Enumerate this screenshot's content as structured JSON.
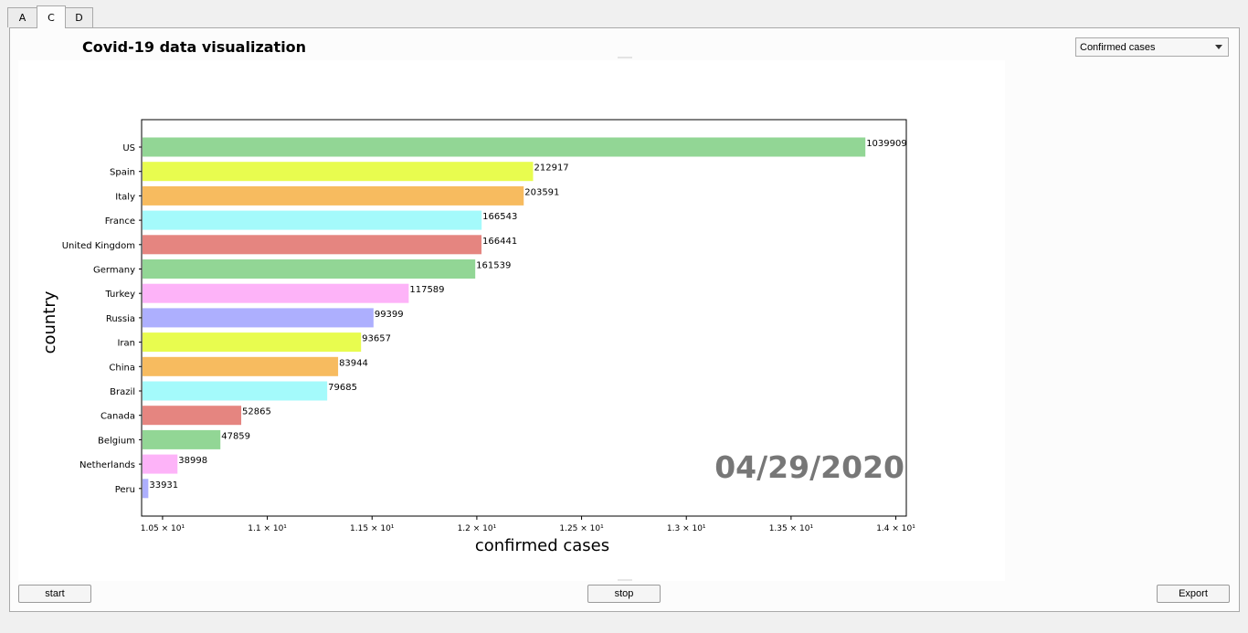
{
  "tabs": [
    {
      "label": "A",
      "active": false
    },
    {
      "label": "C",
      "active": true
    },
    {
      "label": "D",
      "active": false
    }
  ],
  "title": "Covid-19 data visualization",
  "dropdown": {
    "selected": "Confirmed cases"
  },
  "buttons": {
    "start": "start",
    "stop": "stop",
    "export": "Export"
  },
  "chart_data": {
    "type": "bar",
    "orientation": "horizontal",
    "xlabel": "confirmed cases",
    "ylabel": "country",
    "x_scale": "log",
    "xlim": [
      10.4,
      14.05
    ],
    "xticks": [
      {
        "value": 10.5,
        "label": "1.05 × 10¹"
      },
      {
        "value": 11.0,
        "label": "1.1 × 10¹"
      },
      {
        "value": 11.5,
        "label": "1.15 × 10¹"
      },
      {
        "value": 12.0,
        "label": "1.2 × 10¹"
      },
      {
        "value": 12.5,
        "label": "1.25 × 10¹"
      },
      {
        "value": 13.0,
        "label": "1.3 × 10¹"
      },
      {
        "value": 13.5,
        "label": "1.35 × 10¹"
      },
      {
        "value": 14.0,
        "label": "1.4 × 10¹"
      }
    ],
    "date_label": "04/29/2020",
    "grid": false,
    "bars": [
      {
        "country": "US",
        "value": 1039909,
        "color": "#92d695"
      },
      {
        "country": "Spain",
        "value": 212917,
        "color": "#e8fc4f"
      },
      {
        "country": "Italy",
        "value": 203591,
        "color": "#f7bb5f"
      },
      {
        "country": "France",
        "value": 166543,
        "color": "#a4fafb"
      },
      {
        "country": "United Kingdom",
        "value": 166441,
        "color": "#e58580"
      },
      {
        "country": "Germany",
        "value": 161539,
        "color": "#92d695"
      },
      {
        "country": "Turkey",
        "value": 117589,
        "color": "#fdb3f8"
      },
      {
        "country": "Russia",
        "value": 99399,
        "color": "#adaffe"
      },
      {
        "country": "Iran",
        "value": 93657,
        "color": "#e8fc4f"
      },
      {
        "country": "China",
        "value": 83944,
        "color": "#f7bb5f"
      },
      {
        "country": "Brazil",
        "value": 79685,
        "color": "#a4fafb"
      },
      {
        "country": "Canada",
        "value": 52865,
        "color": "#e58580"
      },
      {
        "country": "Belgium",
        "value": 47859,
        "color": "#92d695"
      },
      {
        "country": "Netherlands",
        "value": 38998,
        "color": "#fdb3f8"
      },
      {
        "country": "Peru",
        "value": 33931,
        "color": "#adaffe"
      }
    ]
  }
}
